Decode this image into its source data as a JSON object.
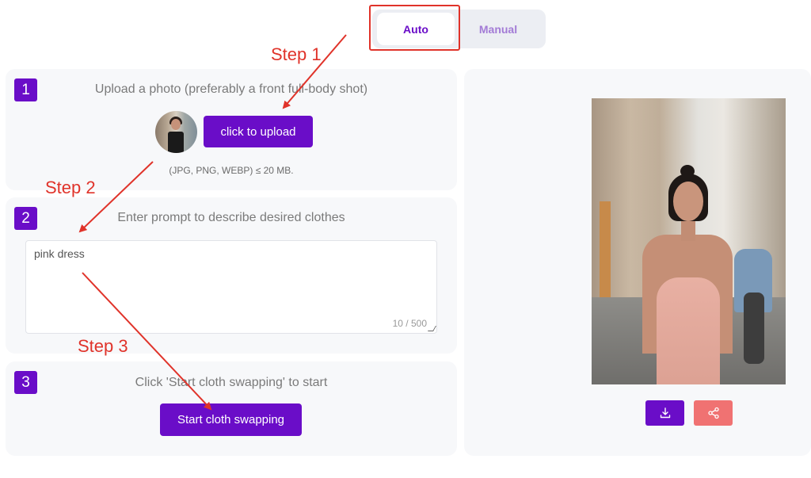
{
  "mode_toggle": {
    "options": [
      {
        "label": "Auto",
        "selected": true
      },
      {
        "label": "Manual",
        "selected": false
      }
    ]
  },
  "steps": [
    {
      "number": "1",
      "title": "Upload a photo (preferably a front full-body shot)",
      "button_label": "click to upload",
      "hint": "(JPG, PNG, WEBP) ≤ 20 MB."
    },
    {
      "number": "2",
      "title": "Enter prompt to describe desired clothes",
      "prompt_value": "pink dress",
      "char_count": "10 / 500"
    },
    {
      "number": "3",
      "title": "Click 'Start cloth swapping' to start",
      "button_label": "Start cloth swapping"
    }
  ],
  "result": {
    "download_icon": "download-icon",
    "share_icon": "share-icon"
  },
  "annotations": {
    "step1": "Step 1",
    "step2": "Step 2",
    "step3": "Step 3"
  },
  "colors": {
    "accent": "#6a0dc8",
    "share": "#f07272",
    "annotation": "#e0332a",
    "panel_bg": "#f7f8fa"
  }
}
